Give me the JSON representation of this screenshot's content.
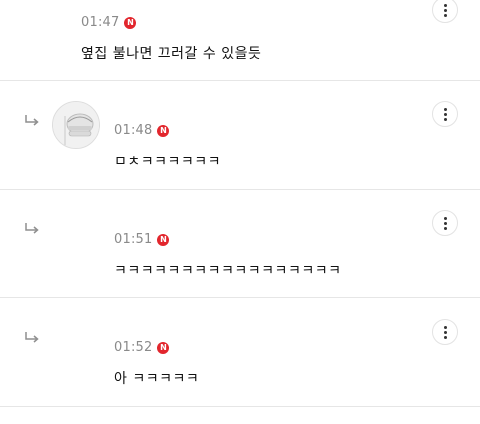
{
  "comments": [
    {
      "time": "01:47",
      "badge": "N",
      "text": "옆집 불나면 끄러갈 수 있을듯",
      "is_reply": false
    },
    {
      "time": "01:48",
      "badge": "N",
      "text": "ㅁㅊㅋㅋㅋㅋㅋㅋ",
      "is_reply": true
    },
    {
      "time": "01:51",
      "badge": "N",
      "text": "ㅋㅋㅋㅋㅋㅋㅋㅋㅋㅋㅋㅋㅋㅋㅋㅋㅋ",
      "is_reply": true
    },
    {
      "time": "01:52",
      "badge": "N",
      "text": "아 ㅋㅋㅋㅋㅋ",
      "is_reply": true
    }
  ],
  "icons": {
    "more": "kebab-menu-icon",
    "reply": "reply-arrow-icon",
    "new": "new-badge-icon",
    "avatar": "avatar-image"
  },
  "colors": {
    "badge": "#e2262d",
    "time": "#8a8a8a",
    "divider": "#e6e6e6"
  }
}
